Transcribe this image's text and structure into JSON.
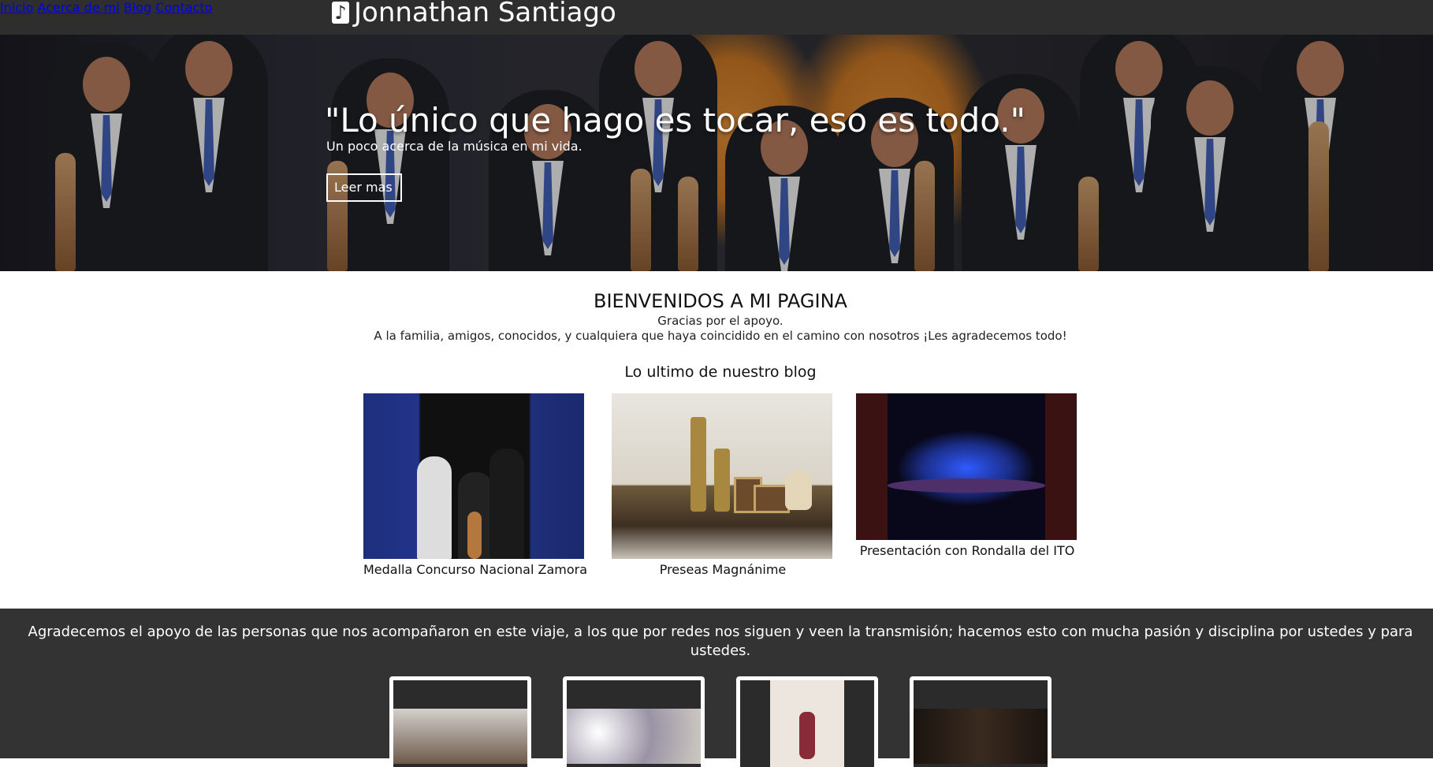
{
  "nav": {
    "brand": "Jonnathan Santiago",
    "brand_icon": "music-note-icon",
    "links": [
      "Inicio",
      "Acerca de mi",
      "Blog",
      "Contacto"
    ]
  },
  "hero": {
    "quote": "\"Lo único que hago es tocar, eso es todo.\"",
    "subtitle": "Un poco acerca de la música en mi vida.",
    "button": "Leer mas"
  },
  "welcome": {
    "title": "BIENVENIDOS A MI PAGINA",
    "line1": "Gracias por el apoyo.",
    "line2": "A la familia, amigos, conocidos, y cualquiera que haya coincidido en el camino con nosotros ¡Les agradecemos todo!"
  },
  "blog": {
    "heading": "Lo ultimo de nuestro blog",
    "posts": [
      {
        "caption": "Medalla Concurso Nacional Zamora"
      },
      {
        "caption": "Preseas Magnánime"
      },
      {
        "caption": "Presentación con Rondalla del ITO"
      }
    ]
  },
  "footer_section": {
    "text": "Agradecemos el apoyo de las personas que nos acompañaron en este viaje, a los que por redes nos siguen y veen la transmisión; hacemos esto con mucha pasión y disciplina por ustedes y para ustedes."
  },
  "colors": {
    "nav_bg": "#2e2e2e",
    "bottom_bg": "#333333",
    "text_white": "#ffffff"
  }
}
